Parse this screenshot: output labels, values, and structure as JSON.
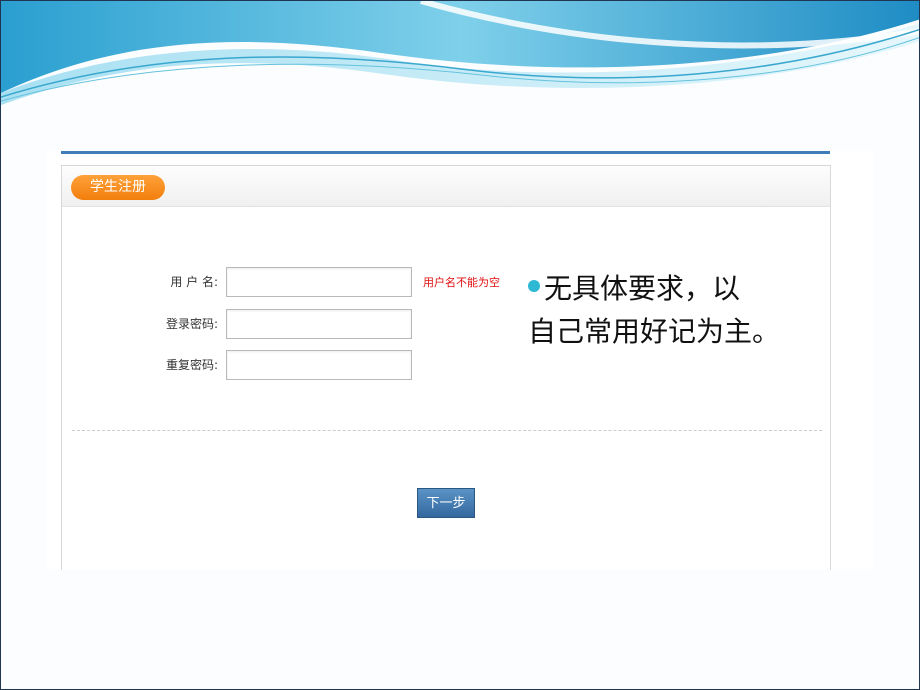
{
  "form": {
    "title": "学生注册",
    "fields": [
      {
        "label": "用 户 名:",
        "value": "",
        "error": "用户名不能为空"
      },
      {
        "label": "登录密码:",
        "value": ""
      },
      {
        "label": "重复密码:",
        "value": ""
      }
    ],
    "next_button": "下一步"
  },
  "note": {
    "line1": "无具体要求，以",
    "line2": "自己常用好记为主。"
  },
  "colors": {
    "accent_orange": "#f28a17",
    "button_blue": "#3f78b0",
    "error_red": "#e01010",
    "bullet_cyan": "#2fb8d4"
  }
}
